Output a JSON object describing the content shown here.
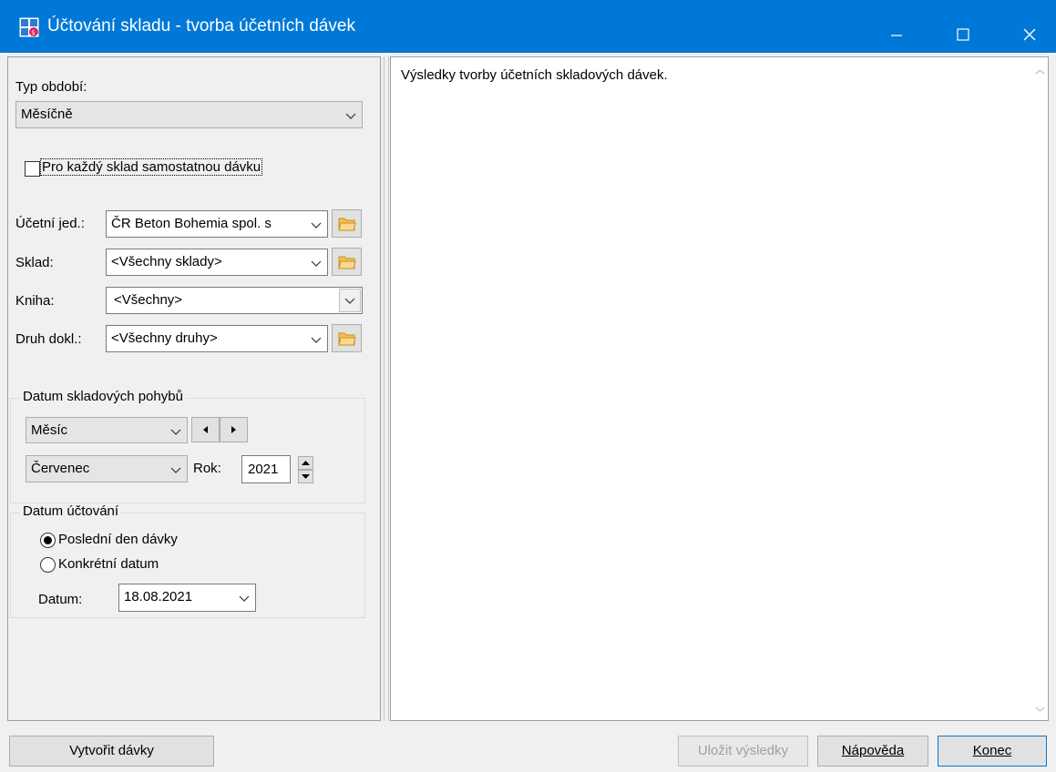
{
  "window": {
    "title": "Účtování skladu - tvorba účetních dávek",
    "titlebar_color": "#0078d7"
  },
  "left": {
    "period_type_label": "Typ období:",
    "period_type_value": "Měsíčně",
    "separate_batch_label": "Pro každý sklad samostatnou dávku",
    "unit_label": "Účetní jed.:",
    "unit_value": "ČR Beton Bohemia spol. s",
    "warehouse_label": "Sklad:",
    "warehouse_value": "<Všechny sklady>",
    "book_label": "Kniha:",
    "book_value": "<Všechny>",
    "doctype_label": "Druh dokl.:",
    "doctype_value": "<Všechny druhy>",
    "movements_group": {
      "title": "Datum skladových pohybů",
      "period_value": "Měsíc",
      "month_value": "Červenec",
      "year_label": "Rok:",
      "year_value": "2021"
    },
    "posting_group": {
      "title": "Datum účtování",
      "option_last_day": "Poslední den dávky",
      "option_specific": "Konkrétní datum",
      "date_label": "Datum:",
      "date_value": "18.08.2021"
    }
  },
  "right": {
    "result_text": "Výsledky tvorby účetních skladových dávek."
  },
  "buttons": {
    "create": "Vytvořit dávky",
    "save_results": "Uložit výsledky",
    "help": "Nápověda",
    "close": "Konec"
  },
  "icons": {
    "app": "app-icon",
    "folder": "folder-icon",
    "chevron": "chevron-down-icon"
  }
}
